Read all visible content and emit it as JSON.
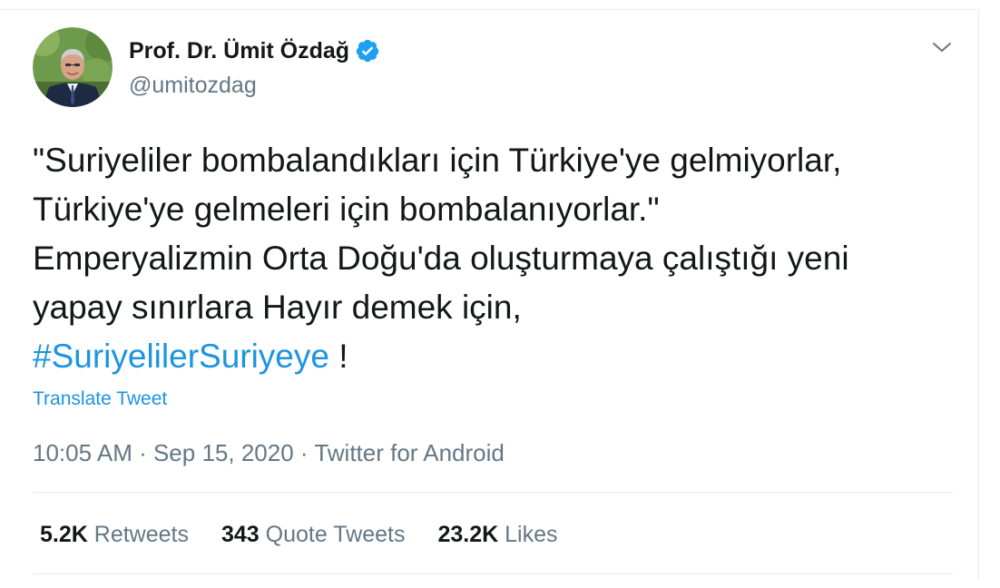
{
  "author": {
    "name": "Prof. Dr. Ümit Özdağ",
    "handle": "@umitozdag"
  },
  "tweet": {
    "lines": [
      "\"Suriyeliler bombalandıkları için Türkiye'ye gelmiyorlar,",
      "Türkiye'ye gelmeleri için bombalanıyorlar.\"",
      "Emperyalizmin Orta Doğu'da oluşturmaya çalıştığı yeni",
      "yapay sınırlara Hayır demek için,"
    ],
    "hashtag": "#SuriyelilerSuriyeye",
    "after_hashtag": " !",
    "translate_label": "Translate Tweet",
    "time": "10:05 AM",
    "date": "Sep 15, 2020",
    "source": "Twitter for Android",
    "separator": " · "
  },
  "stats": {
    "retweets": {
      "count": "5.2K",
      "label": "Retweets"
    },
    "quotes": {
      "count": "343",
      "label": "Quote Tweets"
    },
    "likes": {
      "count": "23.2K",
      "label": "Likes"
    }
  },
  "colors": {
    "link": "#1b95e0",
    "text": "#14171a",
    "muted": "#657786",
    "verified": "#1da1f2"
  },
  "icons": {
    "verified": "verified-badge-icon",
    "caret": "chevron-down-icon"
  }
}
